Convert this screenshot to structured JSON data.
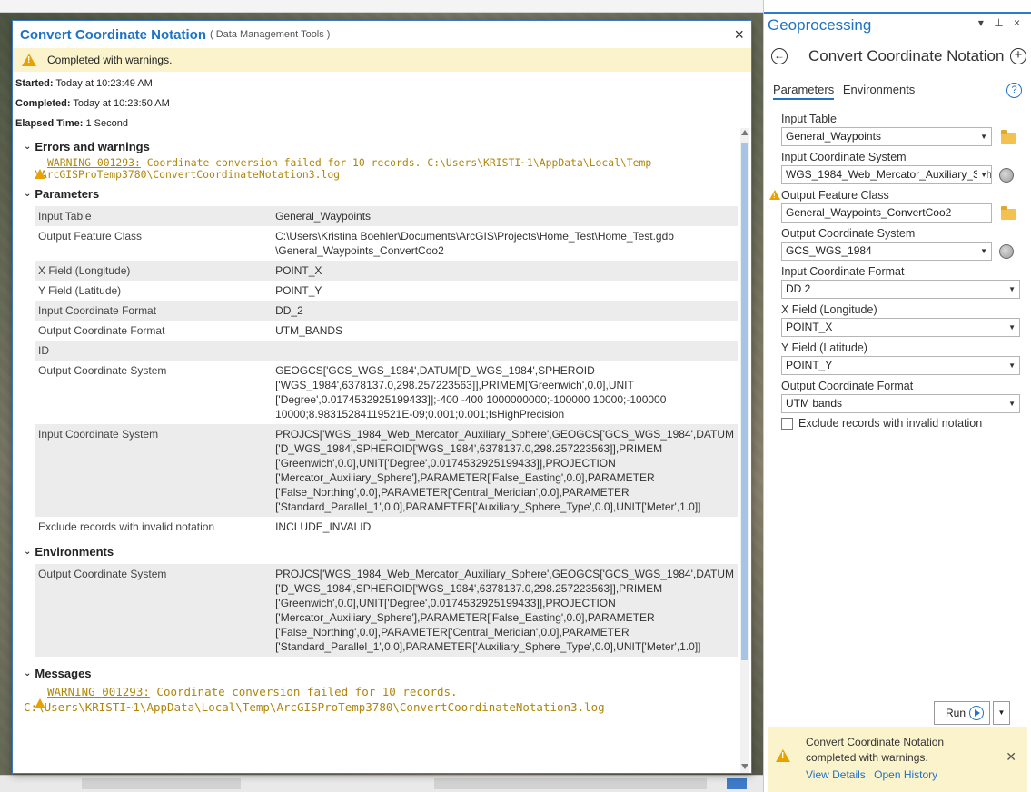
{
  "dialog": {
    "title": "Convert Coordinate Notation",
    "subtitle": "( Data Management Tools )",
    "close": "×",
    "status": "Completed with warnings.",
    "meta": [
      {
        "label": "Started:",
        "value": "Today at 10:23:49 AM"
      },
      {
        "label": "Completed:",
        "value": "Today at 10:23:50 AM"
      },
      {
        "label": "Elapsed Time:",
        "value": "1 Second"
      }
    ],
    "errors_header": "Errors and warnings",
    "warning_code": "WARNING 001293:",
    "warning_text_1": "Coordinate conversion failed for 10 records. C:\\Users\\KRISTI~1\\AppData\\Local\\Temp",
    "warning_text_2": "\\ArcGISProTemp3780\\ConvertCoordinateNotation3.log",
    "parameters_header": "Parameters",
    "parameters": [
      {
        "k": "Input Table",
        "v": "General_Waypoints"
      },
      {
        "k": "Output Feature Class",
        "v": "C:\\Users\\Kristina Boehler\\Documents\\ArcGIS\\Projects\\Home_Test\\Home_Test.gdb\n\\General_Waypoints_ConvertCoo2"
      },
      {
        "k": "X Field (Longitude)",
        "v": "POINT_X"
      },
      {
        "k": "Y Field (Latitude)",
        "v": "POINT_Y"
      },
      {
        "k": "Input Coordinate Format",
        "v": "DD_2"
      },
      {
        "k": "Output Coordinate Format",
        "v": "UTM_BANDS"
      },
      {
        "k": "ID",
        "v": ""
      },
      {
        "k": "Output Coordinate System",
        "v": "GEOGCS['GCS_WGS_1984',DATUM['D_WGS_1984',SPHEROID\n['WGS_1984',6378137.0,298.257223563]],PRIMEM['Greenwich',0.0],UNIT\n['Degree',0.0174532925199433]];-400 -400 1000000000;-100000 10000;-100000\n10000;8.98315284119521E-09;0.001;0.001;IsHighPrecision"
      },
      {
        "k": "Input Coordinate System",
        "v": "PROJCS['WGS_1984_Web_Mercator_Auxiliary_Sphere',GEOGCS['GCS_WGS_1984',DATUM\n['D_WGS_1984',SPHEROID['WGS_1984',6378137.0,298.257223563]],PRIMEM\n['Greenwich',0.0],UNIT['Degree',0.0174532925199433]],PROJECTION\n['Mercator_Auxiliary_Sphere'],PARAMETER['False_Easting',0.0],PARAMETER\n['False_Northing',0.0],PARAMETER['Central_Meridian',0.0],PARAMETER\n['Standard_Parallel_1',0.0],PARAMETER['Auxiliary_Sphere_Type',0.0],UNIT['Meter',1.0]]"
      },
      {
        "k": "Exclude records with invalid notation",
        "v": "INCLUDE_INVALID"
      }
    ],
    "environments_header": "Environments",
    "environments": [
      {
        "k": "Output Coordinate System",
        "v": "PROJCS['WGS_1984_Web_Mercator_Auxiliary_Sphere',GEOGCS['GCS_WGS_1984',DATUM\n['D_WGS_1984',SPHEROID['WGS_1984',6378137.0,298.257223563]],PRIMEM\n['Greenwich',0.0],UNIT['Degree',0.0174532925199433]],PROJECTION\n['Mercator_Auxiliary_Sphere'],PARAMETER['False_Easting',0.0],PARAMETER\n['False_Northing',0.0],PARAMETER['Central_Meridian',0.0],PARAMETER\n['Standard_Parallel_1',0.0],PARAMETER['Auxiliary_Sphere_Type',0.0],UNIT['Meter',1.0]]"
      }
    ],
    "messages_header": "Messages",
    "msg_code": "WARNING 001293:",
    "msg_text_1": "Coordinate conversion failed for 10 records.",
    "msg_text_2": "C:\\Users\\KRISTI~1\\AppData\\Local\\Temp\\ArcGISProTemp3780\\ConvertCoordinateNotation3.log"
  },
  "gp": {
    "title": "Geoprocessing",
    "controls": "▾ ⊥ ×",
    "tool_name": "Convert Coordinate Notation",
    "tab_parameters": "Parameters",
    "tab_environments": "Environments",
    "help": "?",
    "input_table_label": "Input Table",
    "input_table_value": "General_Waypoints",
    "input_cs_label": "Input Coordinate System",
    "input_cs_value": "WGS_1984_Web_Mercator_Auxiliary_Sphe",
    "output_fc_label": "Output Feature Class",
    "output_fc_value": "General_Waypoints_ConvertCoo2",
    "output_cs_label": "Output Coordinate System",
    "output_cs_value": "GCS_WGS_1984",
    "input_fmt_label": "Input Coordinate Format",
    "input_fmt_value": "DD 2",
    "x_field_label": "X Field (Longitude)",
    "x_field_value": "POINT_X",
    "y_field_label": "Y Field (Latitude)",
    "y_field_value": "POINT_Y",
    "output_fmt_label": "Output Coordinate Format",
    "output_fmt_value": "UTM bands",
    "exclude_label": "Exclude records with invalid notation",
    "run_label": "Run",
    "status_msg": "Convert Coordinate Notation completed with warnings.",
    "view_details": "View Details",
    "open_history": "Open History"
  }
}
